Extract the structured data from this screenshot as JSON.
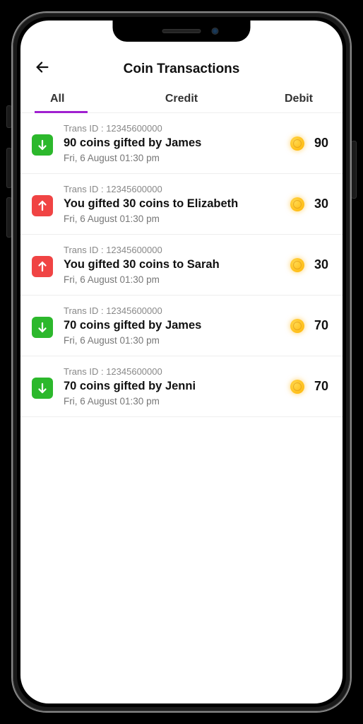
{
  "header": {
    "title": "Coin Transactions"
  },
  "tabs": {
    "all": "All",
    "credit": "Credit",
    "debit": "Debit",
    "active": "all"
  },
  "trans_label_prefix": "Trans ID : ",
  "transactions": [
    {
      "id": "12345600000",
      "direction": "credit",
      "title": "90 coins gifted by James",
      "date": "Fri, 6 August 01:30 pm",
      "amount": "90"
    },
    {
      "id": "12345600000",
      "direction": "debit",
      "title": "You gifted 30 coins to Elizabeth",
      "date": "Fri, 6 August 01:30 pm",
      "amount": "30"
    },
    {
      "id": "12345600000",
      "direction": "debit",
      "title": "You gifted 30 coins to Sarah",
      "date": "Fri, 6 August 01:30 pm",
      "amount": "30"
    },
    {
      "id": "12345600000",
      "direction": "credit",
      "title": "70 coins gifted by James",
      "date": "Fri, 6 August 01:30 pm",
      "amount": "70"
    },
    {
      "id": "12345600000",
      "direction": "credit",
      "title": "70 coins gifted by Jenni",
      "date": "Fri, 6 August 01:30 pm",
      "amount": "70"
    }
  ]
}
